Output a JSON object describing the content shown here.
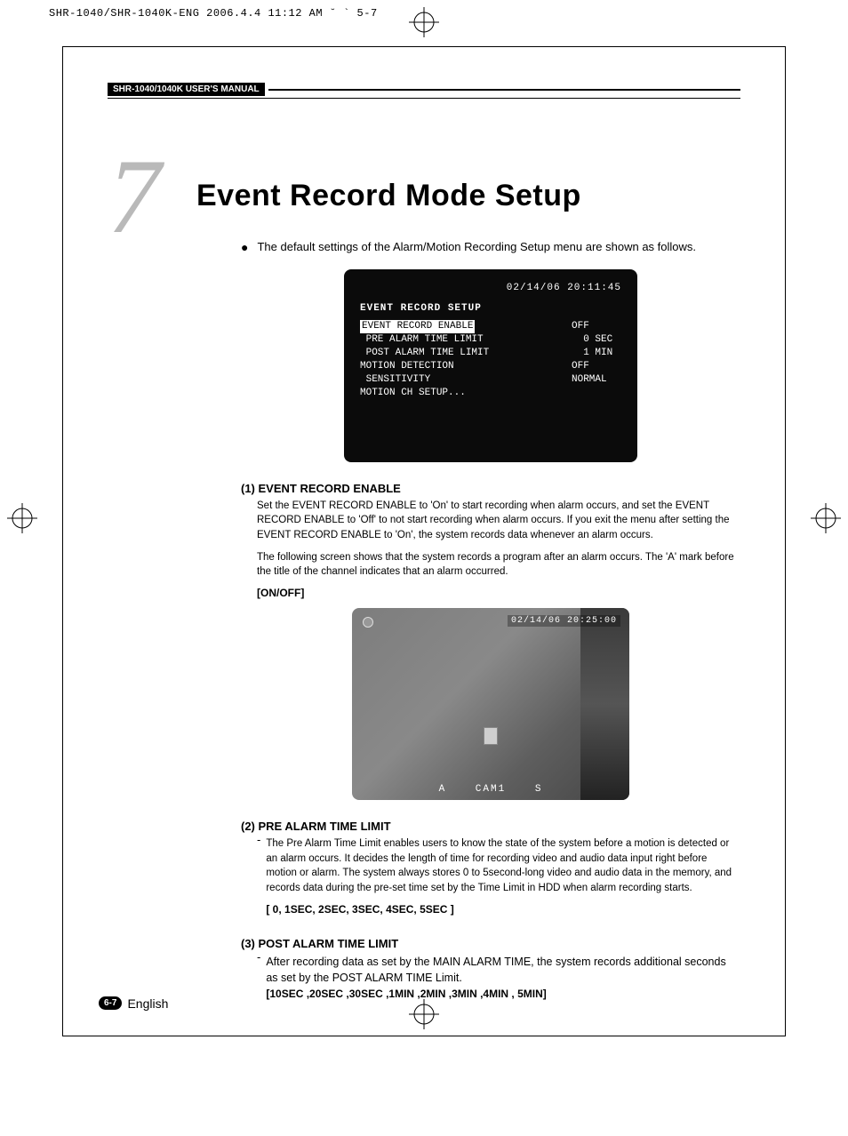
{
  "meta_line": "SHR-1040/SHR-1040K-ENG  2006.4.4 11:12 AM  ˘ ` 5-7",
  "manual_label": "SHR-1040/1040K USER'S MANUAL",
  "chapter_number": "7",
  "chapter_title": "Event Record Mode Setup",
  "intro": "The default settings of the Alarm/Motion Recording Setup menu are shown as follows.",
  "osd": {
    "timestamp": "02/14/06   20:11:45",
    "header": "EVENT RECORD SETUP",
    "rows": [
      {
        "label": "EVENT RECORD ENABLE",
        "value": "OFF"
      },
      {
        "label": " PRE ALARM TIME LIMIT",
        "value": "  0 SEC"
      },
      {
        "label": " POST ALARM TIME LIMIT",
        "value": "  1 MIN"
      },
      {
        "label": "MOTION DETECTION",
        "value": "OFF"
      },
      {
        "label": " SENSITIVITY",
        "value": "NORMAL"
      },
      {
        "label": "MOTION CH SETUP...",
        "value": ""
      }
    ]
  },
  "sec1": {
    "head": "(1) EVENT RECORD ENABLE",
    "body": "Set the EVENT RECORD ENABLE to 'On' to start recording when alarm occurs, and set the EVENT RECORD ENABLE to 'Off' to not start recording when alarm occurs. If you exit the menu after setting the EVENT RECORD ENABLE to 'On', the system records data whenever an alarm occurs.",
    "body2": "The following screen shows that the system records a program after an alarm occurs. The 'A' mark before the title of the channel indicates that an alarm occurred.",
    "opts": "[ON/OFF]"
  },
  "cam": {
    "timestamp": "02/14/06  20:25:00",
    "a": "A",
    "cam": "CAM1",
    "s": "S"
  },
  "sec2": {
    "head": "(2) PRE ALARM TIME LIMIT",
    "body": "The Pre Alarm Time Limit enables users to know the state of the system before a motion is detected or an alarm occurs. It decides the length of time for recording video and audio data input right before motion or alarm. The system always stores 0 to 5second-long video and audio data in the memory, and records data during the pre-set time set by the Time Limit in HDD when alarm recording starts.",
    "opts": "[ 0, 1SEC, 2SEC, 3SEC, 4SEC, 5SEC ]"
  },
  "sec3": {
    "head": "(3) POST ALARM TIME LIMIT",
    "body": "After recording data as set by the MAIN ALARM TIME, the system records additional seconds as set by the POST ALARM TIME Limit.",
    "opts": "[10SEC ,20SEC ,30SEC ,1MIN ,2MIN ,3MIN ,4MIN , 5MIN]"
  },
  "page_badge": "6-7",
  "page_lang": "English"
}
